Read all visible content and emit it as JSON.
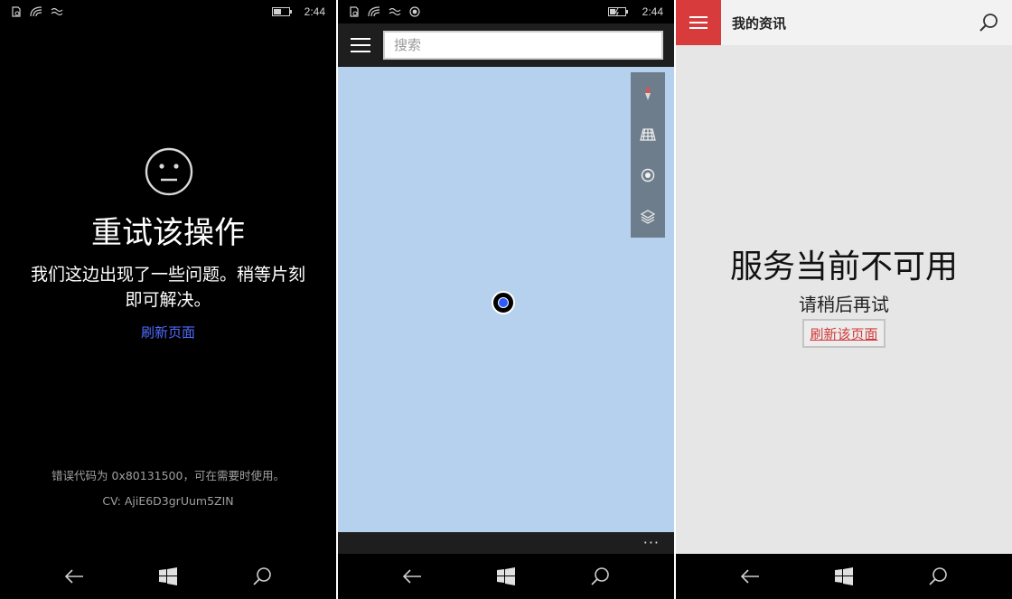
{
  "statusbar": {
    "time": "2:44"
  },
  "panel1": {
    "title": "重试该操作",
    "message": "我们这边出现了一些问题。稍等片刻即可解决。",
    "refresh_link": "刷新页面",
    "error_code": "错误代码为 0x80131500，可在需要时使用。",
    "cv": "CV: AjiE6D3grUum5ZIN"
  },
  "panel2": {
    "search": {
      "placeholder": "搜索"
    },
    "tools": [
      "compass-icon",
      "grid-icon",
      "location-icon",
      "layers-icon"
    ],
    "more_label": "···"
  },
  "panel3": {
    "header_title": "我的资讯",
    "main_message": "服务当前不可用",
    "sub_message": "请稍后再试",
    "refresh_button": "刷新该页面"
  },
  "colors": {
    "accent_red": "#d83b3b",
    "link_blue": "#4f6bff",
    "map_water": "#b5d1ee",
    "location_blue": "#2f5bff"
  }
}
